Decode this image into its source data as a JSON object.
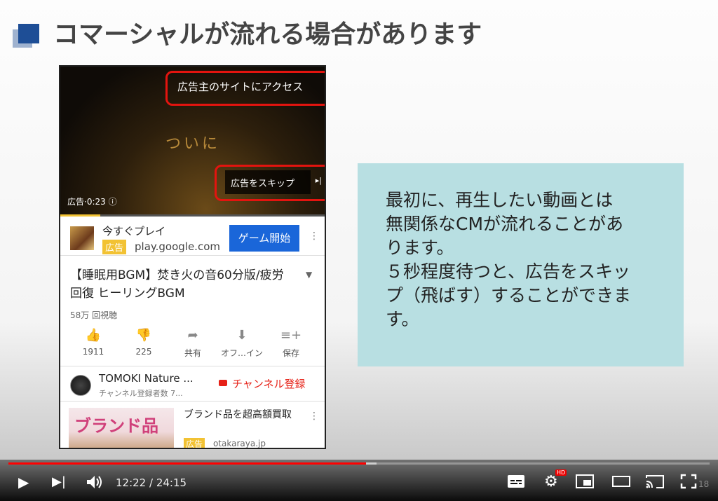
{
  "slide": {
    "title": "コマーシャルが流れる場合があります",
    "note": "最初に、再生したい動画とは\n無関係なCMが流れることがあ\nります。\n５秒程度待つと、広告をスキッ\nプ（飛ばす）することができま\nす。"
  },
  "ad_player": {
    "advertiser_link": "広告主のサイトにアクセス",
    "caption": "ついに",
    "skip_label": "広告をスキップ",
    "skip_icon": "▸|",
    "timer": "広告·0:23 ⓘ",
    "progress": 0.15
  },
  "ad_row": {
    "app_name": "今すぐプレイ",
    "badge": "広告",
    "domain": "play.google.com",
    "install_label": "ゲーム開始"
  },
  "video": {
    "title": "【睡眠用BGM】焚き火の音60分版/疲労回復 ヒーリングBGM",
    "views": "58万 回視聴"
  },
  "actions": [
    {
      "icon": "thumbs-up-icon",
      "glyph": "👍",
      "label": "1911"
    },
    {
      "icon": "thumbs-down-icon",
      "glyph": "👎",
      "label": "225"
    },
    {
      "icon": "share-icon",
      "glyph": "➦",
      "label": "共有"
    },
    {
      "icon": "download-icon",
      "glyph": "⬇",
      "label": "オフ…イン"
    },
    {
      "icon": "save-playlist-icon",
      "glyph": "≡+",
      "label": "保存"
    }
  ],
  "channel": {
    "name": "TOMOKI Nature ...",
    "subs": "チャンネル登録者数 7...",
    "subscribe_label": "チャンネル登録"
  },
  "promo": {
    "image_text": "ブランド品",
    "title": "ブランド品を超高額買取",
    "badge": "広告",
    "domain": "otakaraya.jp"
  },
  "player": {
    "time": "12:22 / 24:15",
    "played_fraction": 0.51,
    "buffered_fraction": 0.525,
    "hd_badge": "HD",
    "corner_number": "18"
  },
  "colors": {
    "highlight_red": "#e3140f",
    "title_mark": "#1e4e96",
    "note_background": "#b8dfe2",
    "progress_red": "#ff0000",
    "ad_yellow": "#f2c233",
    "install_blue": "#1a66d9"
  }
}
